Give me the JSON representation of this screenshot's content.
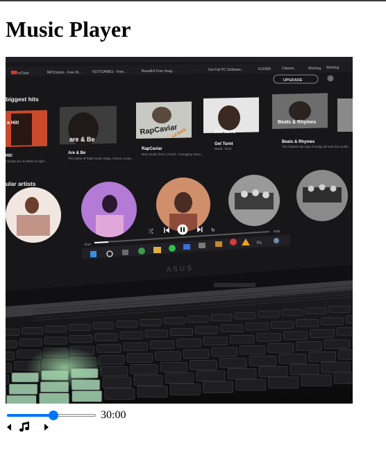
{
  "page": {
    "title": "Music Player"
  },
  "player": {
    "time_display": "30:00",
    "progress_fraction": 0.52,
    "prev_icon": "caret-left-icon",
    "music_icon": "music-note-icon",
    "next_icon": "caret-right-icon"
  },
  "cover_image": {
    "bookmarks": [
      "YouTube",
      "MP3Juices - Free M...",
      "IGOTGAMES - Free...",
      "Beautiful Free Imag...",
      "Get Full PC Software...",
      "KLEMIX",
      "Classes",
      "Working",
      "Working"
    ],
    "upgrade_label": "UPGRADE",
    "section_hits": "biggest hits",
    "section_artists": "ular artists",
    "cards": [
      {
        "art": "a Hit!",
        "title": "Hit!",
        "desc": "t songs you to listen to right..."
      },
      {
        "art": "are & Be",
        "title": "Are & Be",
        "desc": "The pulse of R&B music today. Coven Lucky..."
      },
      {
        "art": "RapCaviar",
        "sub": "Lil Durk",
        "title": "RapCaviar",
        "desc": "New music from Lil Durk, YoungBoy Neve..."
      },
      {
        "art": "Get Turnt",
        "title": "Get Turnt",
        "desc": "Mode: Turnt"
      },
      {
        "art": "Beats & Rhymes",
        "title": "Beats & Rhymes",
        "desc": "The hottest Hip-Hop of today all over the world..."
      }
    ],
    "time_elapsed": "0:17",
    "time_total": "3:23",
    "brand": "ASUS",
    "ps_label": "Ps"
  }
}
